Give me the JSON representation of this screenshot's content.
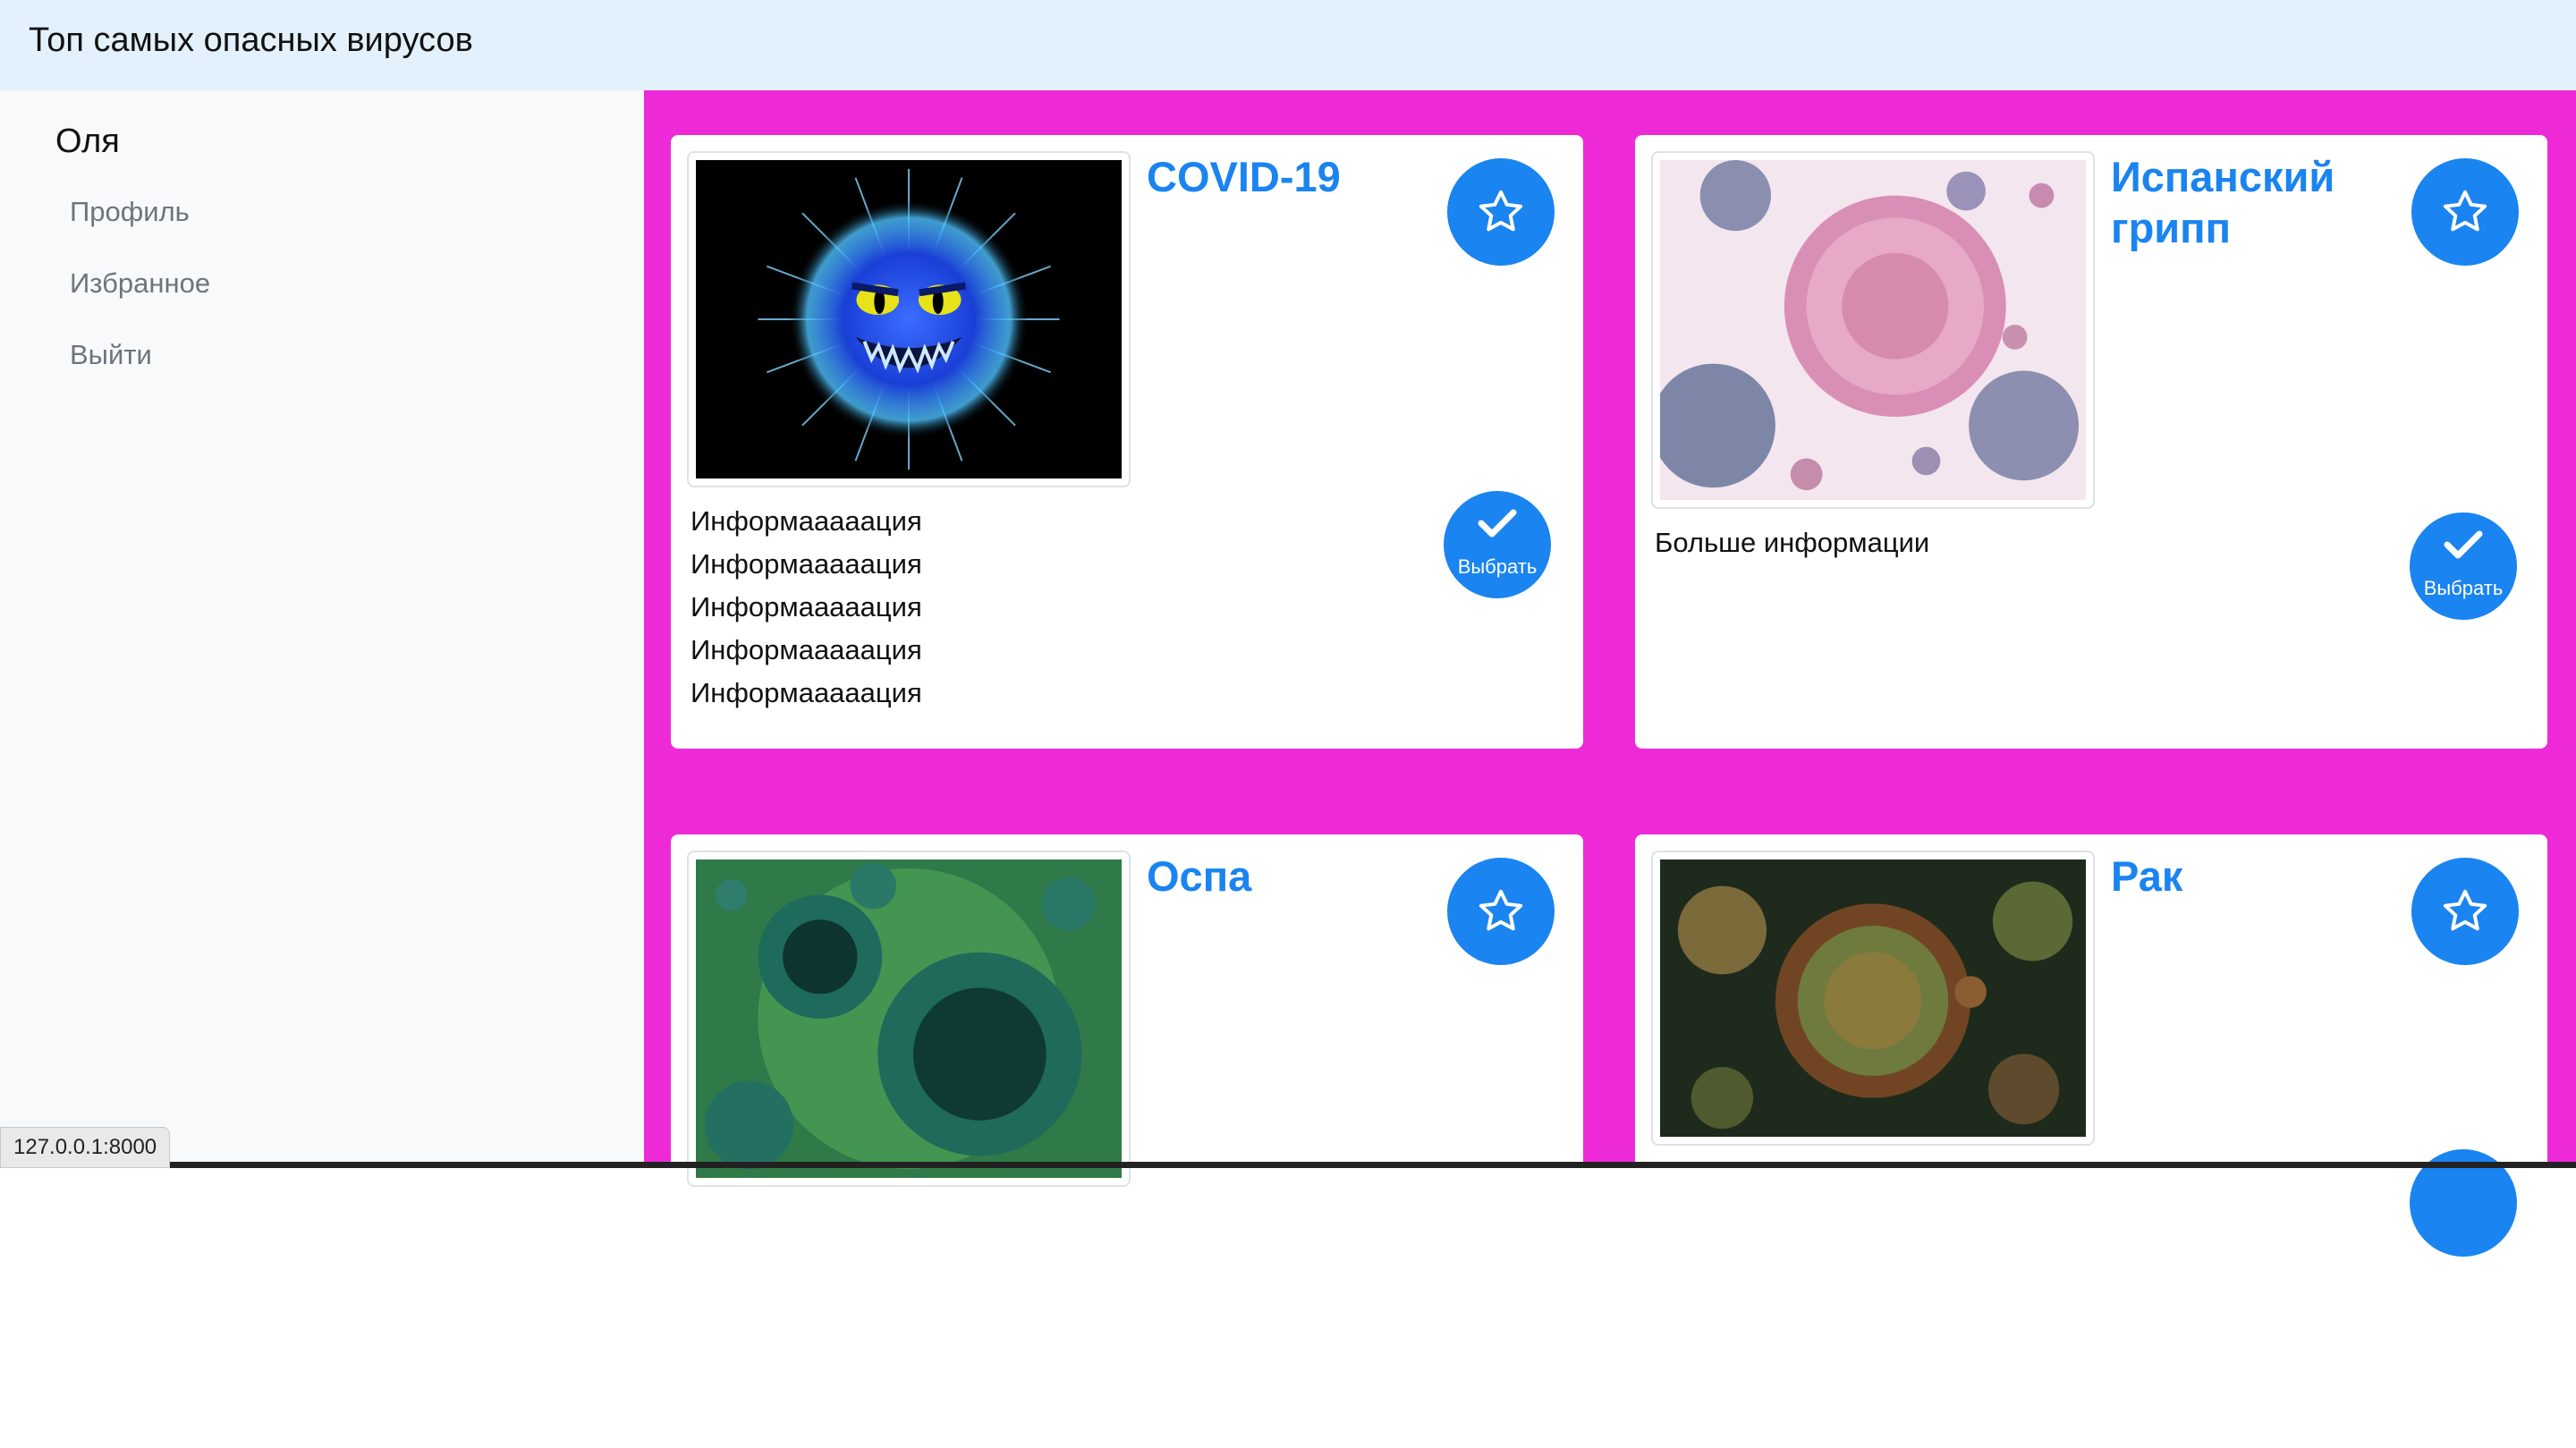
{
  "header": {
    "brand": "Топ самых опасных вирусов"
  },
  "sidebar": {
    "user": "Оля",
    "links": [
      "Профиль",
      "Избранное",
      "Выйти"
    ]
  },
  "cards": [
    {
      "title": "COVID-19",
      "info": "Информааааация\nИнформааааация\nИнформааааация\nИнформааааация\nИнформааааация\nИнформааааация",
      "select_label": "Выбрать"
    },
    {
      "title": "Испанский грипп",
      "info": "Больше информации",
      "select_label": "Выбрать"
    },
    {
      "title": "Оспа"
    },
    {
      "title": "Рак"
    }
  ],
  "status_bar": {
    "url": "127.0.0.1:8000"
  },
  "colors": {
    "accent": "#1a84f0",
    "main_bg": "#ee2ad8",
    "topbar": "#e3f1fc",
    "sidebar": "#f8f9fa"
  }
}
